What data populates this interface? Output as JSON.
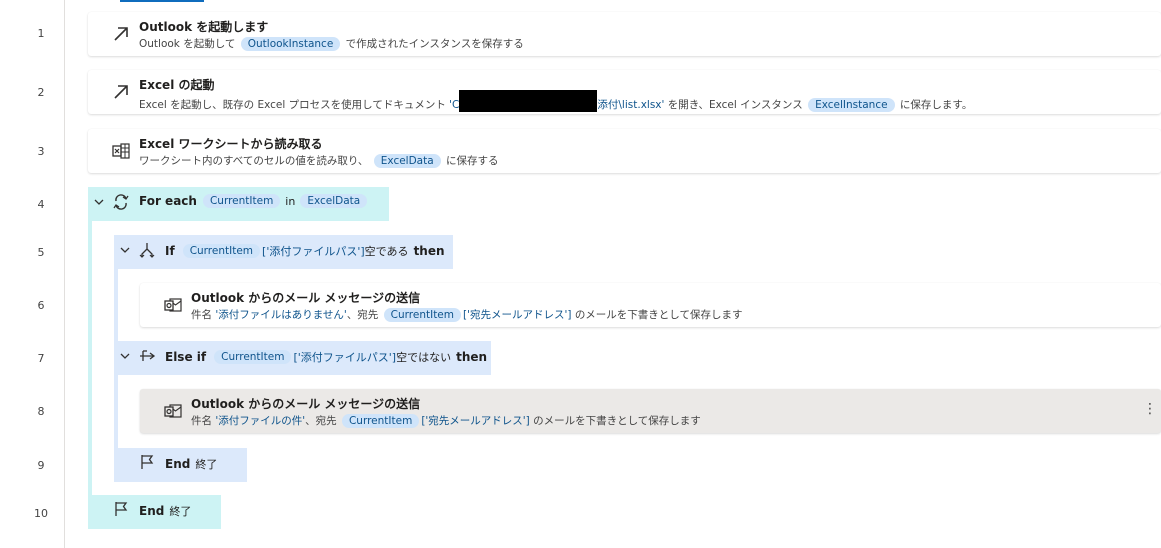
{
  "line_numbers": [
    "1",
    "2",
    "3",
    "4",
    "5",
    "6",
    "7",
    "8",
    "9",
    "10"
  ],
  "steps": {
    "s1": {
      "title": "Outlook を起動します",
      "desc_a": "Outlook を起動して",
      "var1": "OutlookInstance",
      "desc_b": "で作成されたインスタンスを保存する"
    },
    "s2": {
      "title": "Excel の起動",
      "desc_a": "Excel を起動し、既存の Excel プロセスを使用してドキュメント ",
      "path_start": "'C",
      "path_end": "添付\\list.xlsx'",
      "desc_b": " を開き、Excel インスタンス",
      "var1": "ExcelInstance",
      "desc_c": "に保存します。"
    },
    "s3": {
      "title": "Excel ワークシートから読み取る",
      "desc_a": "ワークシート内のすべてのセルの値を読み取り、",
      "var1": "ExcelData",
      "desc_b": "に保存する"
    },
    "s4": {
      "keyword": "For each",
      "var1": "CurrentItem",
      "in": "in",
      "var2": "ExcelData"
    },
    "s5": {
      "keyword": "If",
      "var1": "CurrentItem",
      "field": "['添付ファイルパス']",
      "cond": "空である",
      "then": "then"
    },
    "s6": {
      "title": "Outlook からのメール メッセージの送信",
      "desc_a": "件名 ",
      "subject": "'添付ファイルはありません'",
      "desc_b": "、宛先",
      "var1": "CurrentItem",
      "field": "['宛先メールアドレス']",
      "desc_c": "のメールを下書きとして保存します"
    },
    "s7": {
      "keyword": "Else if",
      "var1": "CurrentItem",
      "field": "['添付ファイルパス']",
      "cond": "空ではない",
      "then": "then"
    },
    "s8": {
      "title": "Outlook からのメール メッセージの送信",
      "desc_a": "件名 ",
      "subject": "'添付ファイルの件'",
      "desc_b": "、宛先",
      "var1": "CurrentItem",
      "field": "['宛先メールアドレス']",
      "desc_c": "のメールを下書きとして保存します",
      "more_icon": "⋮"
    },
    "s9": {
      "keyword": "End",
      "label": "終了"
    },
    "s10": {
      "keyword": "End",
      "label": "終了"
    }
  },
  "icons": {
    "launch": "arrow-up-right-icon",
    "excel_read": "excel-sheet-icon",
    "loop": "loop-icon",
    "if": "branch-icon",
    "elseif": "else-branch-icon",
    "outlook_mail": "outlook-mail-icon",
    "end": "flag-icon"
  },
  "colors": {
    "loop_band": "#cdf3f4",
    "if_band": "#dce9fb",
    "pill_bg": "#cfe4fa",
    "pill_text": "#0f548c",
    "selected_row": "#ebe9e7"
  }
}
